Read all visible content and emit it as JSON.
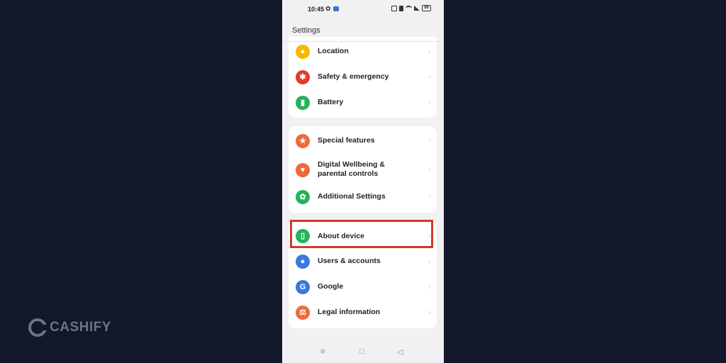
{
  "status_bar": {
    "time": "10:45",
    "battery": "86"
  },
  "header": {
    "title": "Settings"
  },
  "groups": [
    {
      "items": [
        {
          "label": "Location",
          "icon": "location-icon",
          "color": "#f5b800",
          "glyph": "●"
        },
        {
          "label": "Safety & emergency",
          "icon": "asterisk-icon",
          "color": "#e23c2c",
          "glyph": "✱"
        },
        {
          "label": "Battery",
          "icon": "battery-icon",
          "color": "#24b35a",
          "glyph": "▮"
        }
      ]
    },
    {
      "items": [
        {
          "label": "Special features",
          "icon": "star-icon",
          "color": "#ef6a3a",
          "glyph": "★"
        },
        {
          "label": "Digital Wellbeing & parental controls",
          "icon": "wellbeing-icon",
          "color": "#ef6a3a",
          "glyph": "♥"
        },
        {
          "label": "Additional Settings",
          "icon": "gear-icon",
          "color": "#24b35a",
          "glyph": "✿"
        }
      ]
    },
    {
      "items": [
        {
          "label": "About device",
          "icon": "phone-icon",
          "color": "#24b35a",
          "glyph": "▯"
        },
        {
          "label": "Users & accounts",
          "icon": "user-icon",
          "color": "#3b78e0",
          "glyph": "●"
        },
        {
          "label": "Google",
          "icon": "google-icon",
          "color": "#3b78e0",
          "glyph": "G"
        },
        {
          "label": "Legal information",
          "icon": "scale-icon",
          "color": "#ef6a3a",
          "glyph": "⚖"
        }
      ]
    }
  ],
  "nav": {
    "menu_glyph": "≡",
    "home_glyph": "□",
    "back_glyph": "◁"
  },
  "brand": {
    "name": "CASHIFY"
  }
}
